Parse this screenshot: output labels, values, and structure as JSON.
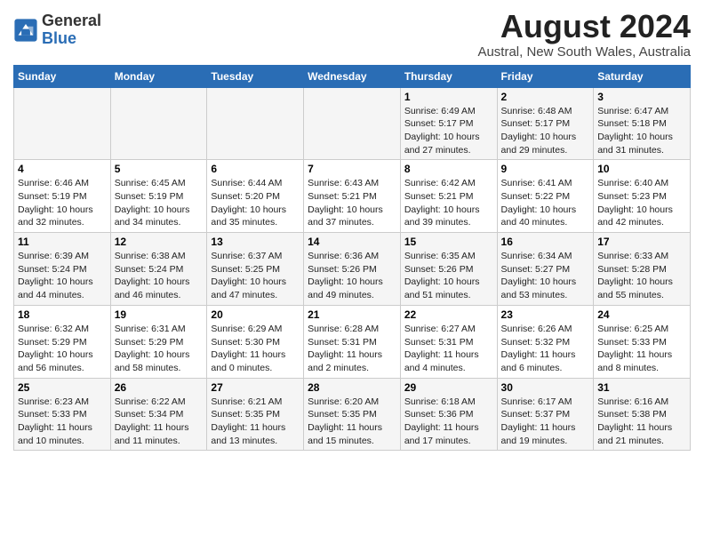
{
  "header": {
    "logo_general": "General",
    "logo_blue": "Blue",
    "title": "August 2024",
    "subtitle": "Austral, New South Wales, Australia"
  },
  "weekdays": [
    "Sunday",
    "Monday",
    "Tuesday",
    "Wednesday",
    "Thursday",
    "Friday",
    "Saturday"
  ],
  "weeks": [
    [
      {
        "day": "",
        "info": ""
      },
      {
        "day": "",
        "info": ""
      },
      {
        "day": "",
        "info": ""
      },
      {
        "day": "",
        "info": ""
      },
      {
        "day": "1",
        "info": "Sunrise: 6:49 AM\nSunset: 5:17 PM\nDaylight: 10 hours\nand 27 minutes."
      },
      {
        "day": "2",
        "info": "Sunrise: 6:48 AM\nSunset: 5:17 PM\nDaylight: 10 hours\nand 29 minutes."
      },
      {
        "day": "3",
        "info": "Sunrise: 6:47 AM\nSunset: 5:18 PM\nDaylight: 10 hours\nand 31 minutes."
      }
    ],
    [
      {
        "day": "4",
        "info": "Sunrise: 6:46 AM\nSunset: 5:19 PM\nDaylight: 10 hours\nand 32 minutes."
      },
      {
        "day": "5",
        "info": "Sunrise: 6:45 AM\nSunset: 5:19 PM\nDaylight: 10 hours\nand 34 minutes."
      },
      {
        "day": "6",
        "info": "Sunrise: 6:44 AM\nSunset: 5:20 PM\nDaylight: 10 hours\nand 35 minutes."
      },
      {
        "day": "7",
        "info": "Sunrise: 6:43 AM\nSunset: 5:21 PM\nDaylight: 10 hours\nand 37 minutes."
      },
      {
        "day": "8",
        "info": "Sunrise: 6:42 AM\nSunset: 5:21 PM\nDaylight: 10 hours\nand 39 minutes."
      },
      {
        "day": "9",
        "info": "Sunrise: 6:41 AM\nSunset: 5:22 PM\nDaylight: 10 hours\nand 40 minutes."
      },
      {
        "day": "10",
        "info": "Sunrise: 6:40 AM\nSunset: 5:23 PM\nDaylight: 10 hours\nand 42 minutes."
      }
    ],
    [
      {
        "day": "11",
        "info": "Sunrise: 6:39 AM\nSunset: 5:24 PM\nDaylight: 10 hours\nand 44 minutes."
      },
      {
        "day": "12",
        "info": "Sunrise: 6:38 AM\nSunset: 5:24 PM\nDaylight: 10 hours\nand 46 minutes."
      },
      {
        "day": "13",
        "info": "Sunrise: 6:37 AM\nSunset: 5:25 PM\nDaylight: 10 hours\nand 47 minutes."
      },
      {
        "day": "14",
        "info": "Sunrise: 6:36 AM\nSunset: 5:26 PM\nDaylight: 10 hours\nand 49 minutes."
      },
      {
        "day": "15",
        "info": "Sunrise: 6:35 AM\nSunset: 5:26 PM\nDaylight: 10 hours\nand 51 minutes."
      },
      {
        "day": "16",
        "info": "Sunrise: 6:34 AM\nSunset: 5:27 PM\nDaylight: 10 hours\nand 53 minutes."
      },
      {
        "day": "17",
        "info": "Sunrise: 6:33 AM\nSunset: 5:28 PM\nDaylight: 10 hours\nand 55 minutes."
      }
    ],
    [
      {
        "day": "18",
        "info": "Sunrise: 6:32 AM\nSunset: 5:29 PM\nDaylight: 10 hours\nand 56 minutes."
      },
      {
        "day": "19",
        "info": "Sunrise: 6:31 AM\nSunset: 5:29 PM\nDaylight: 10 hours\nand 58 minutes."
      },
      {
        "day": "20",
        "info": "Sunrise: 6:29 AM\nSunset: 5:30 PM\nDaylight: 11 hours\nand 0 minutes."
      },
      {
        "day": "21",
        "info": "Sunrise: 6:28 AM\nSunset: 5:31 PM\nDaylight: 11 hours\nand 2 minutes."
      },
      {
        "day": "22",
        "info": "Sunrise: 6:27 AM\nSunset: 5:31 PM\nDaylight: 11 hours\nand 4 minutes."
      },
      {
        "day": "23",
        "info": "Sunrise: 6:26 AM\nSunset: 5:32 PM\nDaylight: 11 hours\nand 6 minutes."
      },
      {
        "day": "24",
        "info": "Sunrise: 6:25 AM\nSunset: 5:33 PM\nDaylight: 11 hours\nand 8 minutes."
      }
    ],
    [
      {
        "day": "25",
        "info": "Sunrise: 6:23 AM\nSunset: 5:33 PM\nDaylight: 11 hours\nand 10 minutes."
      },
      {
        "day": "26",
        "info": "Sunrise: 6:22 AM\nSunset: 5:34 PM\nDaylight: 11 hours\nand 11 minutes."
      },
      {
        "day": "27",
        "info": "Sunrise: 6:21 AM\nSunset: 5:35 PM\nDaylight: 11 hours\nand 13 minutes."
      },
      {
        "day": "28",
        "info": "Sunrise: 6:20 AM\nSunset: 5:35 PM\nDaylight: 11 hours\nand 15 minutes."
      },
      {
        "day": "29",
        "info": "Sunrise: 6:18 AM\nSunset: 5:36 PM\nDaylight: 11 hours\nand 17 minutes."
      },
      {
        "day": "30",
        "info": "Sunrise: 6:17 AM\nSunset: 5:37 PM\nDaylight: 11 hours\nand 19 minutes."
      },
      {
        "day": "31",
        "info": "Sunrise: 6:16 AM\nSunset: 5:38 PM\nDaylight: 11 hours\nand 21 minutes."
      }
    ]
  ]
}
